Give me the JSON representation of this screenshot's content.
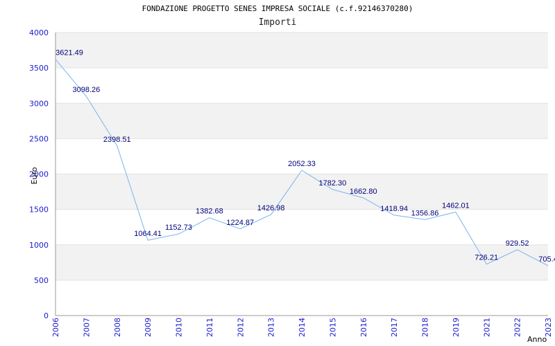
{
  "chart_data": {
    "type": "line",
    "title": "FONDAZIONE PROGETTO SENES IMPRESA SOCIALE (c.f.92146370280)",
    "subtitle": "Importi",
    "xlabel": "Anno",
    "ylabel": "Euro",
    "categories": [
      "2006",
      "2007",
      "2008",
      "2009",
      "2010",
      "2011",
      "2012",
      "2013",
      "2014",
      "2015",
      "2016",
      "2017",
      "2018",
      "2019",
      "2021",
      "2022",
      "2023"
    ],
    "series": [
      {
        "values": [
          3621.49,
          3098.26,
          2398.51,
          1064.41,
          1152.73,
          1382.68,
          1224.87,
          1426.98,
          2052.33,
          1782.3,
          1662.8,
          1418.94,
          1356.86,
          1462.01,
          726.21,
          929.52,
          705.4
        ],
        "labels": [
          "3621.49",
          "3098.26",
          "2398.51",
          "1064.41",
          "1152.73",
          "1382.68",
          "1224.87",
          "1426.98",
          "2052.33",
          "1782.30",
          "1662.80",
          "1418.94",
          "1356.86",
          "1462.01",
          "726.21",
          "929.52",
          "705.4"
        ]
      }
    ],
    "ylim": [
      0,
      4000
    ],
    "yticks": [
      0,
      500,
      1000,
      1500,
      2000,
      2500,
      3000,
      3500,
      4000
    ],
    "grid": true,
    "colors": {
      "line": "#7ab4ee",
      "band": "#f2f2f2",
      "axis": "#1a1acc",
      "labels": "#00007a"
    }
  }
}
